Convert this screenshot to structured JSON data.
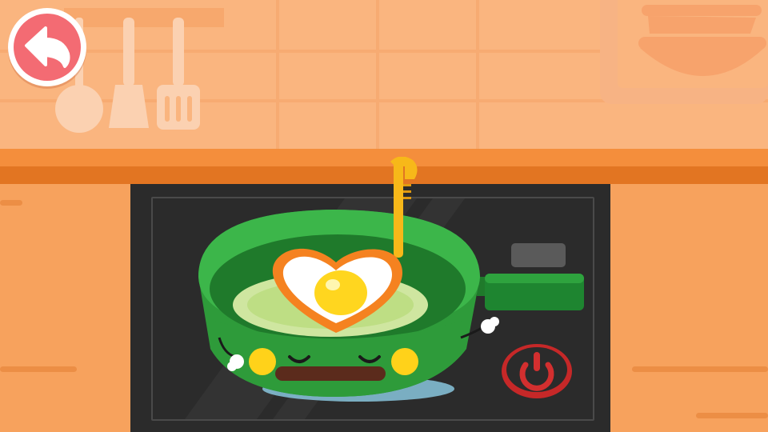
{
  "scene": {
    "name": "kitchen-stove",
    "controls": {
      "back_icon": "back-arrow-icon",
      "power_icon": "power-icon"
    },
    "colors": {
      "wall": "#fab57f",
      "counter": "#f48e3c",
      "cabinet": "#f7a25d",
      "stove": "#2b2b2b",
      "pan": "#2e9b3a",
      "back_button": "#f36b73",
      "power_button": "#d32f2f",
      "egg_yolk": "#ffd61f",
      "egg_mold": "#f58220"
    },
    "pan_character": {
      "expression": "happy-closed-eyes",
      "item": "heart-shaped-fried-egg"
    }
  }
}
